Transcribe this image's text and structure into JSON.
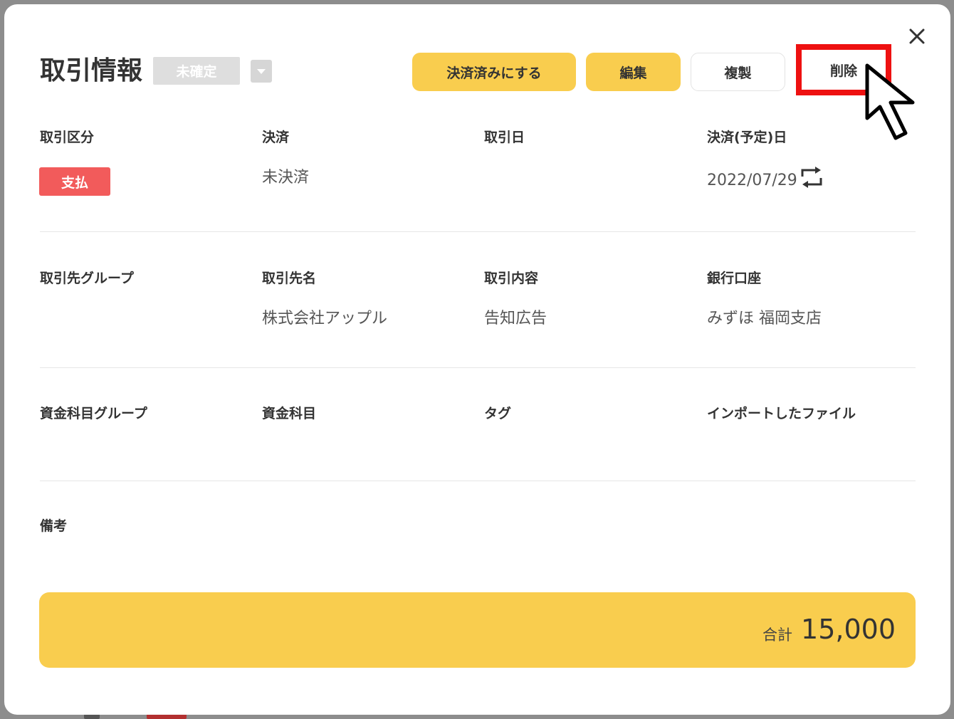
{
  "dialog": {
    "title": "取引情報",
    "status_badge": "未確定",
    "buttons": {
      "settle": "決済済みにする",
      "edit": "編集",
      "copy": "複製",
      "delete": "削除"
    }
  },
  "fields": {
    "transaction_type": {
      "label": "取引区分",
      "value": "支払"
    },
    "settlement": {
      "label": "決済",
      "value": "未決済"
    },
    "transaction_date": {
      "label": "取引日",
      "value": ""
    },
    "settlement_date": {
      "label": "決済(予定)日",
      "value": "2022/07/29"
    },
    "partner_group": {
      "label": "取引先グループ",
      "value": ""
    },
    "partner_name": {
      "label": "取引先名",
      "value": "株式会社アップル"
    },
    "description": {
      "label": "取引内容",
      "value": "告知広告"
    },
    "bank_account": {
      "label": "銀行口座",
      "value": "みずほ 福岡支店"
    },
    "account_group": {
      "label": "資金科目グループ",
      "value": ""
    },
    "account_item": {
      "label": "資金科目",
      "value": ""
    },
    "tag": {
      "label": "タグ",
      "value": ""
    },
    "imported_file": {
      "label": "インポートしたファイル",
      "value": ""
    },
    "remarks": {
      "label": "備考",
      "value": ""
    }
  },
  "total": {
    "label": "合計",
    "value": "15,000"
  },
  "colors": {
    "accent_yellow": "#f9cd4e",
    "payment_red": "#f25b5b",
    "highlight_red": "#ee1111"
  }
}
